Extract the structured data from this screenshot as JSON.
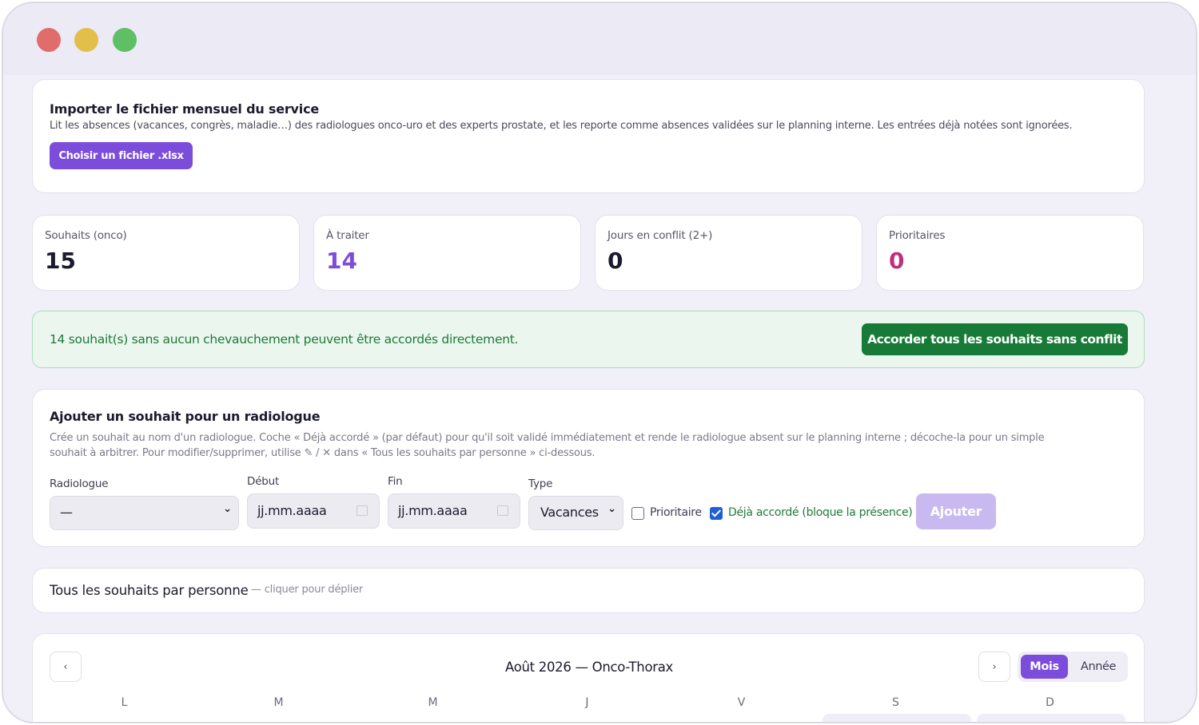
{
  "import": {
    "title": "Importer le fichier mensuel du service",
    "description": "Lit les absences (vacances, congrès, maladie…) des radiologues onco-uro et des experts prostate, et les reporte comme absences validées sur le planning interne. Les entrées déjà notées sont ignorées.",
    "button_label": "Choisir un fichier .xlsx"
  },
  "stats": [
    {
      "label": "Souhaits (onco)",
      "value": "15",
      "color": "#1b1b2e"
    },
    {
      "label": "À traiter",
      "value": "14",
      "color": "#7c4ddb"
    },
    {
      "label": "Jours en conflit (2+)",
      "value": "0",
      "color": "#1b1b2e"
    },
    {
      "label": "Prioritaires",
      "value": "0",
      "color": "#c0307a"
    }
  ],
  "banner": {
    "text": "14 souhait(s) sans aucun chevauchement peuvent être accordés directement.",
    "button_label": "Accorder tous les souhaits sans conflit"
  },
  "add_form": {
    "title": "Ajouter un souhait pour un radiologue",
    "description_line1": "Crée un souhait au nom d'un radiologue. Coche « Déjà accordé » (par défaut) pour qu'il soit validé immédiatement et rende le radiologue absent sur le planning interne ; décoche-la pour un simple",
    "description_line2": "souhait à arbitrer. Pour modifier/supprimer, utilise ✎ / ✕ dans « Tous les souhaits par personne » ci-dessous.",
    "radiologue_label": "Radiologue",
    "radiologue_value": "—",
    "debut_label": "Début",
    "debut_placeholder": "jj.mm.aaaa",
    "fin_label": "Fin",
    "fin_placeholder": "jj.mm.aaaa",
    "type_label": "Type",
    "type_value": "Vacances",
    "prioritaire_label": "Prioritaire",
    "prioritaire_checked": false,
    "deja_label": "Déjà accordé (bloque la présence)",
    "deja_checked": true,
    "submit_label": "Ajouter"
  },
  "all_wishes": {
    "title": "Tous les souhaits par personne",
    "hint": "— cliquer pour déplier"
  },
  "calendar": {
    "title": "Août 2026 — Onco-Thorax",
    "prev_label": "‹",
    "next_label": "›",
    "view_month": "Mois",
    "view_year": "Année",
    "weekdays": [
      "L",
      "M",
      "M",
      "J",
      "V",
      "S",
      "D"
    ]
  },
  "colors": {
    "accent": "#7c4ddb",
    "success": "#177a37",
    "priority": "#c0307a"
  }
}
